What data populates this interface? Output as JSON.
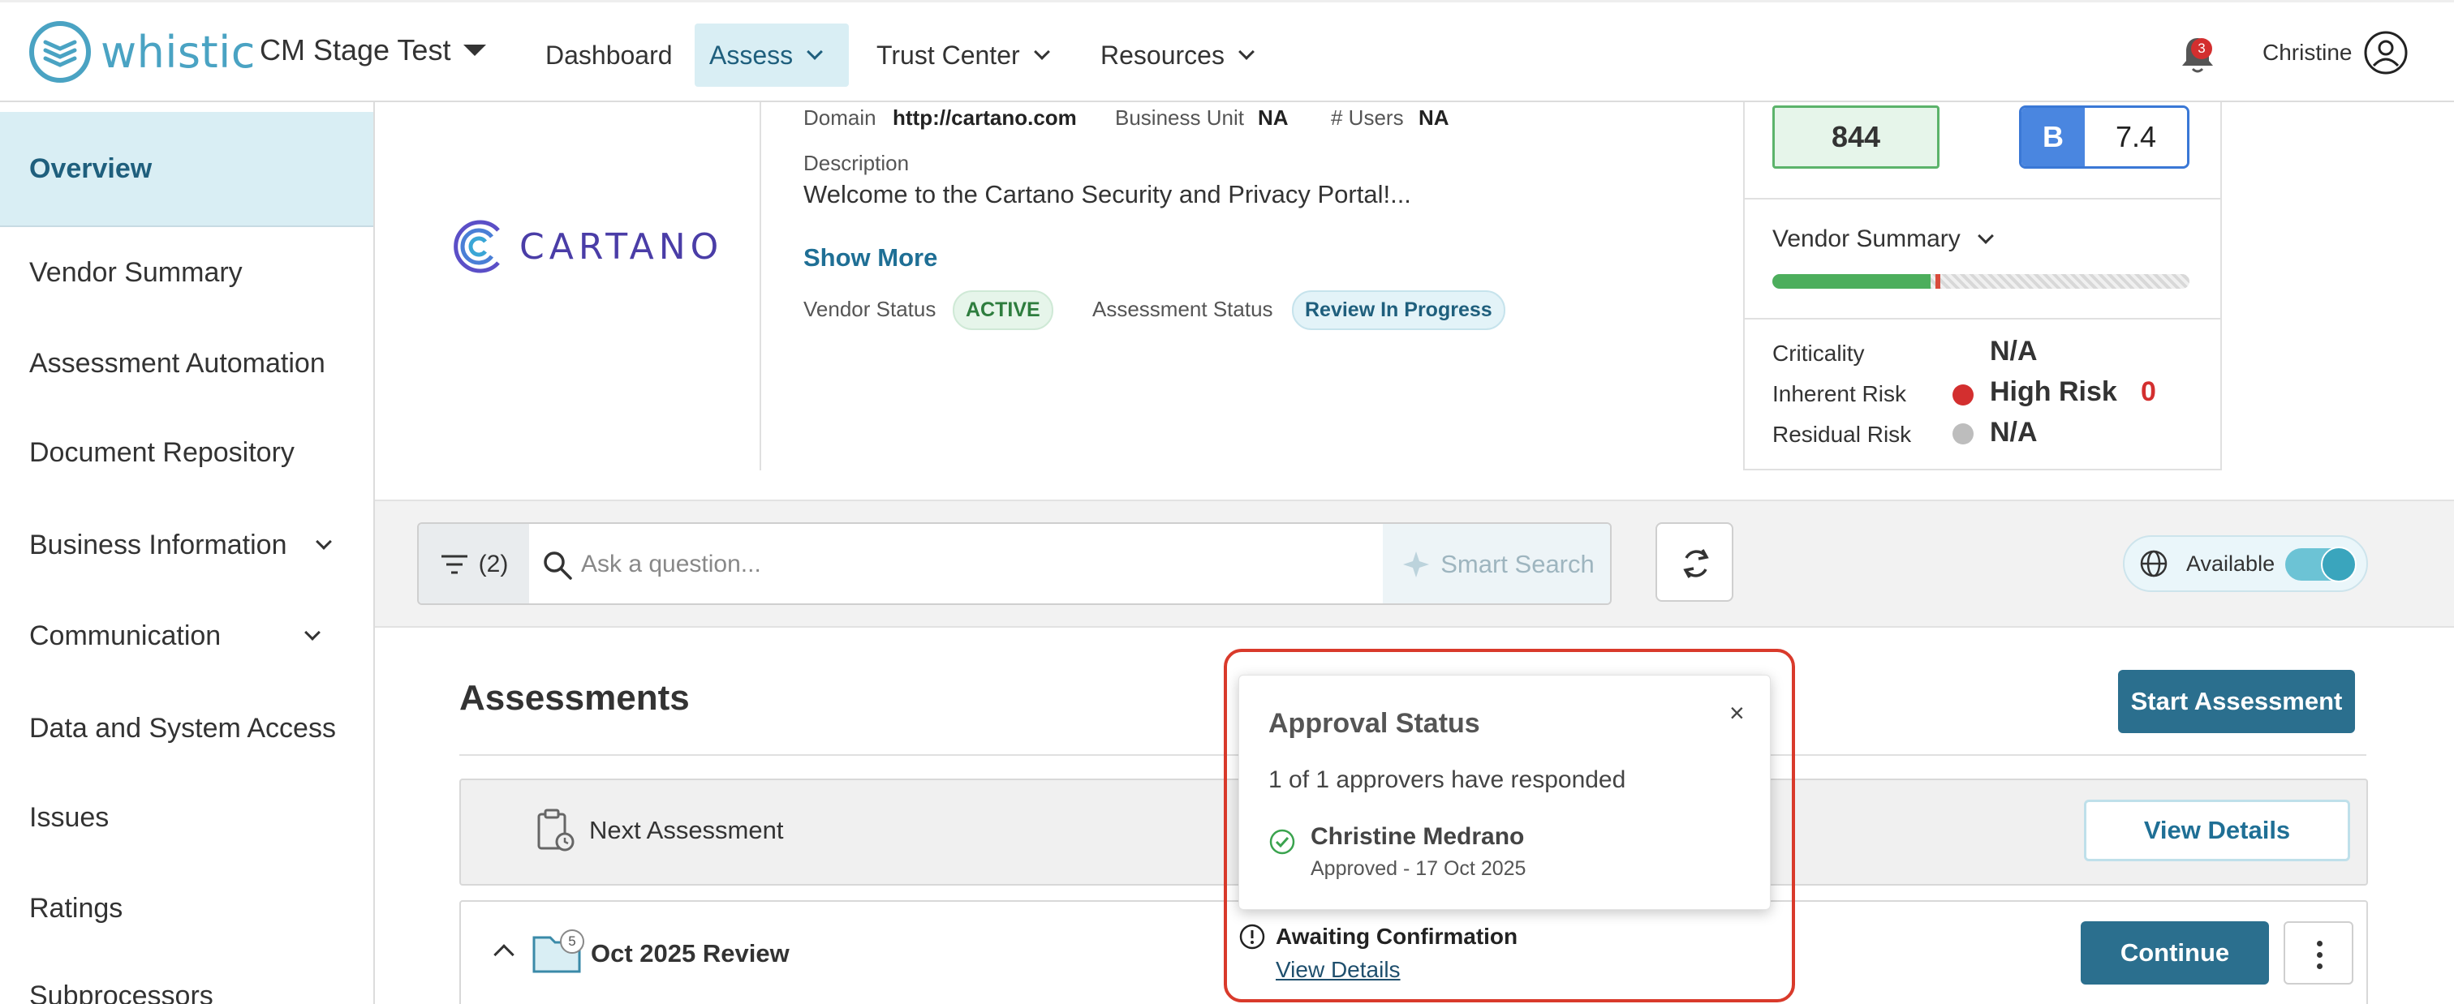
{
  "brand": {
    "name": "whistic",
    "accent": "#2b6f8e",
    "logo_color": "#4aa3c3"
  },
  "header": {
    "org_name": "CM Stage Test",
    "nav": [
      {
        "label": "Dashboard"
      },
      {
        "label": "Assess",
        "active": true
      },
      {
        "label": "Trust Center"
      },
      {
        "label": "Resources"
      }
    ],
    "notifications_count": "3",
    "user_name": "Christine"
  },
  "sidebar": {
    "items": [
      {
        "label": "Overview",
        "active": true
      },
      {
        "label": "Vendor Summary"
      },
      {
        "label": "Assessment Automation"
      },
      {
        "label": "Document Repository"
      },
      {
        "label": "Business Information",
        "expandable": true
      },
      {
        "label": "Communication",
        "expandable": true
      },
      {
        "label": "Data and System Access"
      },
      {
        "label": "Issues"
      },
      {
        "label": "Ratings"
      },
      {
        "label": "Subprocessors"
      }
    ]
  },
  "vendor": {
    "logo_text": "CARTANO",
    "domain_label": "Domain",
    "domain": "http://cartano.com",
    "business_unit_label": "Business Unit",
    "business_unit": "NA",
    "users_label": "# Users",
    "users": "NA",
    "description_label": "Description",
    "description": "Welcome to the Cartano Security and Privacy Portal!...",
    "show_more": "Show More",
    "vendor_status_label": "Vendor Status",
    "vendor_status": "ACTIVE",
    "assessment_status_label": "Assessment Status",
    "assessment_status": "Review In Progress"
  },
  "scores": {
    "score": "844",
    "grade_letter": "B",
    "grade_value": "7.4",
    "vendor_summary_label": "Vendor Summary",
    "summary_progress_percent": 38,
    "criticality_label": "Criticality",
    "criticality": "N/A",
    "inherent_risk_label": "Inherent Risk",
    "inherent_risk": "High Risk",
    "inherent_risk_count": "0",
    "inherent_risk_color": "#d32f2f",
    "residual_risk_label": "Residual Risk",
    "residual_risk": "N/A",
    "residual_risk_color": "#bdbdbd"
  },
  "search": {
    "filter_count": "(2)",
    "placeholder": "Ask a question...",
    "smart_search_label": "Smart Search",
    "availability_label": "Available",
    "availability_on": true
  },
  "assessments": {
    "title": "Assessments",
    "start_button": "Start Assessment",
    "next_label": "Next Assessment",
    "view_details_button": "View Details",
    "review_name": "Oct 2025 Review",
    "review_badge": "5",
    "awaiting_label": "Awaiting Confirmation",
    "awaiting_link": "View Details",
    "continue_button": "Continue"
  },
  "approval_popover": {
    "title": "Approval Status",
    "close": "×",
    "summary": "1 of 1 approvers have responded",
    "approver_name": "Christine Medrano",
    "approver_status": "Approved - 17 Oct 2025"
  }
}
